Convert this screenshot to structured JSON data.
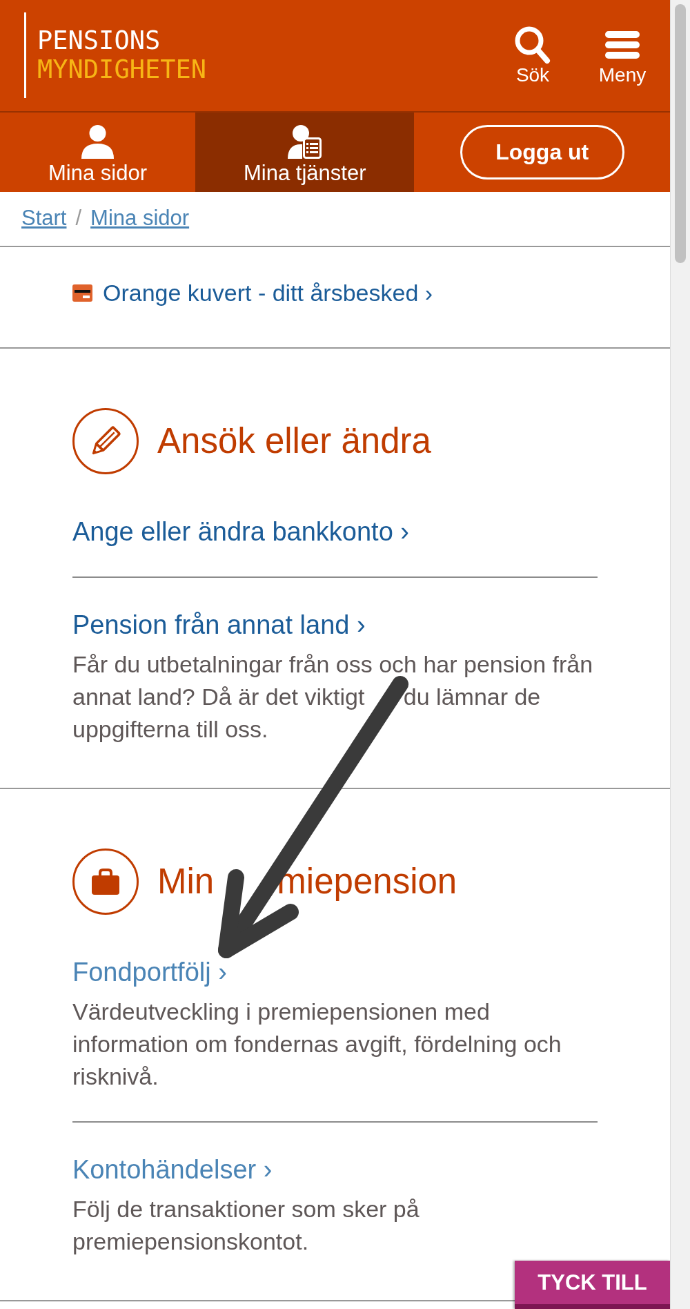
{
  "header": {
    "logo": {
      "line_1": "PENSIONS",
      "line_2": "MYNDIGHETEN"
    },
    "actions": [
      {
        "kind": "search",
        "label": "Sök"
      },
      {
        "kind": "menu",
        "label": "Meny"
      }
    ]
  },
  "nav": {
    "tabs": [
      {
        "kind": "profile",
        "label": "Mina sidor",
        "selected": false
      },
      {
        "kind": "services",
        "label": "Mina tjänster",
        "selected": true
      }
    ],
    "logout_button": {
      "label": "Logga ut"
    }
  },
  "breadcrumb": {
    "items": [
      {
        "label": "Start"
      },
      {
        "label": "Mina sidor"
      }
    ],
    "separator": "/"
  },
  "notice": {
    "label": "Orange kuvert - ditt årsbesked ›"
  },
  "sections": [
    {
      "kind": "edit",
      "title": "Ansök eller ändra",
      "links": [
        {
          "label": "Ange eller ändra bankkonto ›",
          "visited": false
        },
        {
          "label": "Pension från annat land ›",
          "visited": false,
          "description": [
            "Får du utbetalningar från oss och har pension från annat land? Då är det viktigt",
            "du lämnar de uppgifterna till oss."
          ]
        }
      ]
    },
    {
      "kind": "pension",
      "title": [
        "Min",
        "miepension"
      ],
      "links": [
        {
          "label": "Fondportfölj ›",
          "visited": true,
          "description": "Värdeutveckling i premiepensionen med information om fondernas avgift, fördelning och risknivå."
        },
        {
          "label": "Kontohändelser ›",
          "visited": true,
          "description": "Följ de transaktioner som sker på premiepensionskontot."
        }
      ]
    }
  ],
  "feedback_button": {
    "label": "TYCK TILL"
  },
  "overlay": {
    "kind": "arrow"
  }
}
